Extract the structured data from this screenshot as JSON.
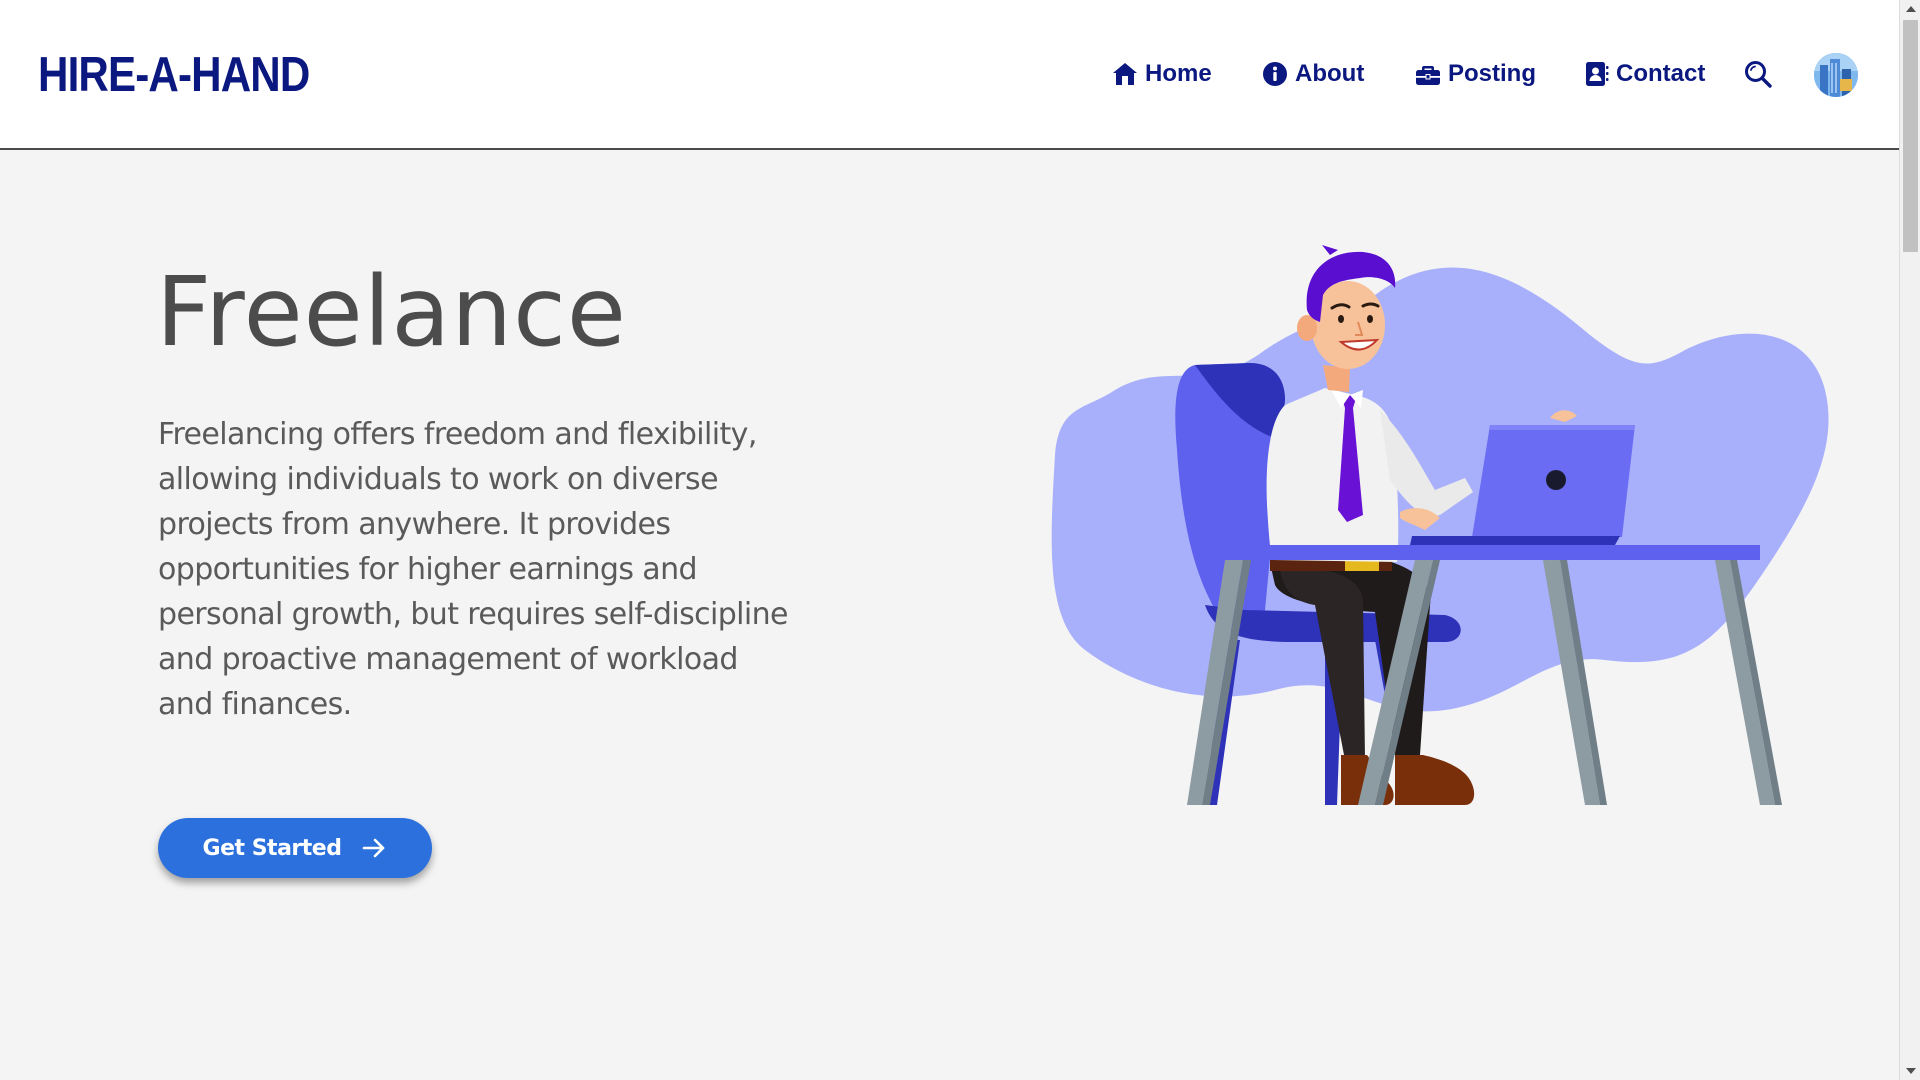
{
  "header": {
    "logo_text": "HIRE-A-HAND",
    "nav": {
      "home": "Home",
      "about": "About",
      "posting": "Posting",
      "contact": "Contact"
    },
    "search_icon": "search-icon",
    "avatar_icon": "user-avatar"
  },
  "hero": {
    "title": "Freelance",
    "description": "Freelancing offers freedom and flexibility, allowing individuals to work on diverse projects from anywhere. It provides opportunities for higher earnings and personal growth, but requires self-discipline and proactive management of workload and finances.",
    "cta_label": "Get Started",
    "cta_icon": "arrow-right-icon",
    "illustration": "freelancer-at-laptop-illustration"
  },
  "colors": {
    "brand_dark": "#0a1880",
    "brand_blue": "#0d2bb8",
    "cta_blue": "#2c70dd",
    "background": "#f4f4f4",
    "blob": "#a9b0fb"
  }
}
